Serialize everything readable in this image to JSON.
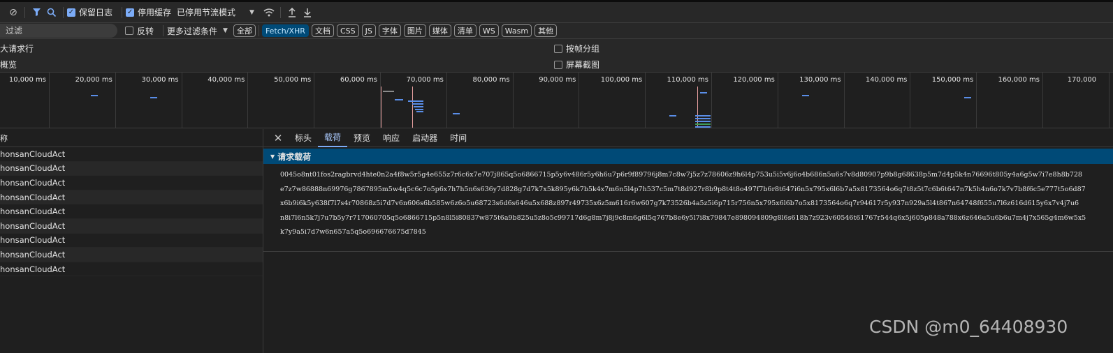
{
  "toolbar": {
    "preserve_log": "保留日志",
    "disable_cache": "停用缓存",
    "throttle_value": "已停用节流模式"
  },
  "filter": {
    "placeholder": "过滤",
    "invert": "反转",
    "more_filters": "更多过滤条件",
    "types": [
      "全部",
      "Fetch/XHR",
      "文档",
      "CSS",
      "JS",
      "字体",
      "图片",
      "媒体",
      "清单",
      "WS",
      "Wasm",
      "其他"
    ]
  },
  "options": {
    "big_rows": "大请求行",
    "overview": "概览",
    "group_by_frame": "按帧分组",
    "screenshots": "屏幕截图"
  },
  "timeline": {
    "ticks": [
      "10,000 ms",
      "20,000 ms",
      "30,000 ms",
      "40,000 ms",
      "50,000 ms",
      "60,000 ms",
      "70,000 ms",
      "80,000 ms",
      "90,000 ms",
      "100,000 ms",
      "110,000 ms",
      "120,000 ms",
      "130,000 ms",
      "140,000 ms",
      "150,000 ms",
      "160,000 ms",
      "170,000"
    ]
  },
  "list": {
    "header": "称",
    "rows": [
      "honsanCloudAct",
      "honsanCloudAct",
      "honsanCloudAct",
      "honsanCloudAct",
      "honsanCloudAct",
      "honsanCloudAct",
      "honsanCloudAct",
      "honsanCloudAct",
      "honsanCloudAct"
    ]
  },
  "detail": {
    "tabs": [
      "标头",
      "载荷",
      "预览",
      "响应",
      "启动器",
      "时间"
    ],
    "section_title": "请求载荷",
    "payload_lines": [
      "0045o8nt01fos2ragbrvd4hte0n2a4f8w5r5g4e655z7r6c6x7e707j865q5o6866715p5y6v486r5y6h6u7p6r9f89796j8m7c8w7j5z7z78606z9h6l4p753u5i5v6j6o4b686n5u6s7v8d80907p9b8g68638p5m7d4p5k4n76696t805y4a6g5w7i7e8h8b728",
      "e7z7w86888n69976g7867895m5w4q5c6c7o5p6x7h7h5n6s636y7d828g7d7k7x5k895y6k7b5k4x7m6n5l4p7h537c5m7t8d927r8b9p8t4t8o497f7b6r8t647i6n5x795x6l6b7a5x8173564o6q7t8z5t7c6b6t647n7k5h4n6o7k7v7b8f6c5e777t5o6d87",
      "x6b9i6k5y638f7l7s4r70868z5i7d7v6n606s6b585w6z6o5u68723s6d6s646u5x688z897r49735x6z5m616r6w607g7k73526b4a5z5i6p715r756n5x795x6l6b7o5x8173564o6q7r94617r5y937n929a5l4t867n64748f655u7l6z616d615y6x7v4j7u6",
      "n8i7l6n5k7j7u7b5y7r717060705q5o6866715p5n8l5i80837w875t6a9b825u5z8o5c99717d6g8m7j8j9c8m6g6l5q767b8e6y5l7i8x79847e898094809g8l6s618h7z923v60546t61767r544q6x5j605p848a788x6z646u5u6b6u7m4j7x565g4m6w5x5",
      "k7y9a5i7d7w6n657a5q5o696676675d7845"
    ]
  },
  "watermark": "CSDN @m0_64408930"
}
